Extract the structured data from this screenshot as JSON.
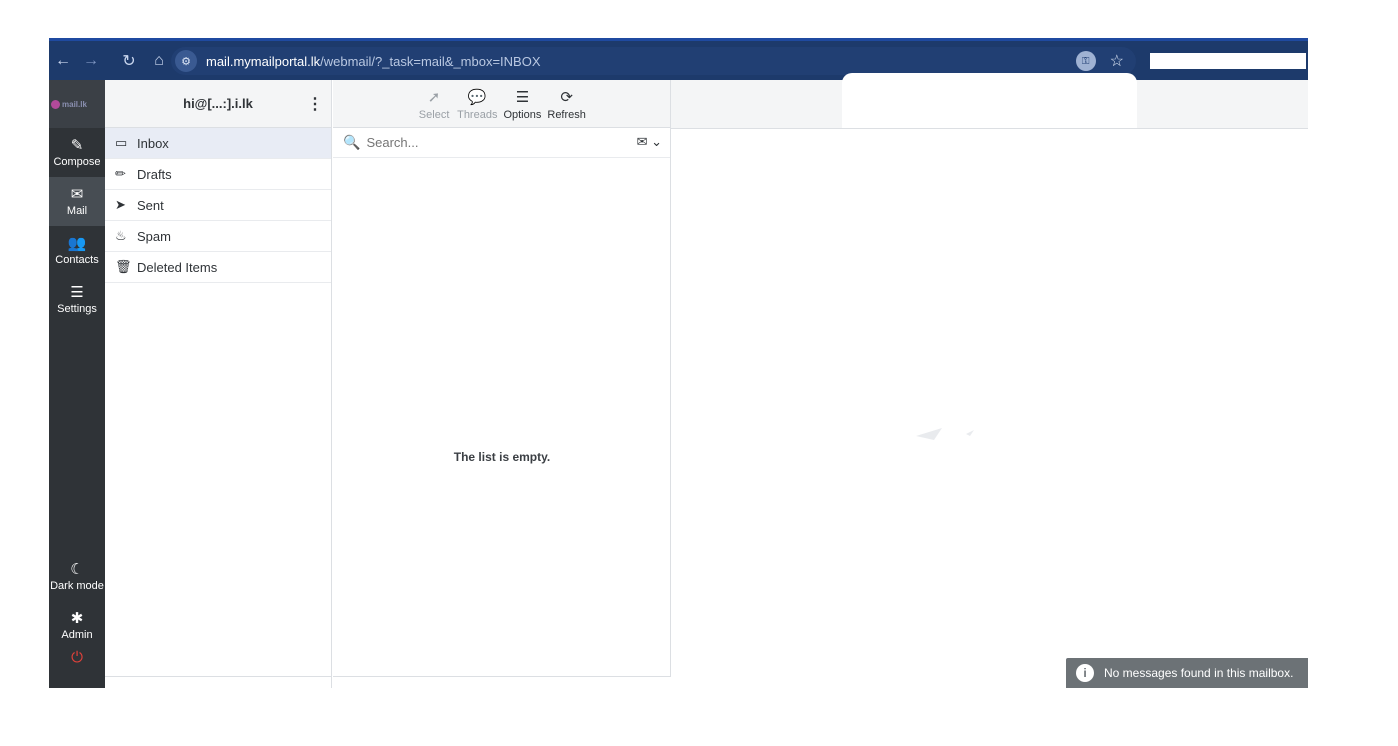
{
  "browser": {
    "url_host": "mail.mymailportal.lk",
    "url_path": "/webmail/?_task=mail&_mbox=INBOX"
  },
  "logo": {
    "text": "mail.lk"
  },
  "taskmenu": {
    "compose": "Compose",
    "mail": "Mail",
    "contacts": "Contacts",
    "settings": "Settings",
    "dark_mode": "Dark mode",
    "admin": "Admin"
  },
  "account": {
    "email": "hi@[...:].i.lk"
  },
  "folders": [
    {
      "label": "Inbox",
      "icon": "inbox-icon",
      "selected": true
    },
    {
      "label": "Drafts",
      "icon": "pencil-icon"
    },
    {
      "label": "Sent",
      "icon": "paper-plane-icon"
    },
    {
      "label": "Spam",
      "icon": "fire-icon"
    },
    {
      "label": "Deleted Items",
      "icon": "trash-icon"
    }
  ],
  "toolbar": {
    "select": "Select",
    "threads": "Threads",
    "options": "Options",
    "refresh": "Refresh"
  },
  "search": {
    "placeholder": "Search..."
  },
  "messagelist": {
    "empty_text": "The list is empty."
  },
  "toast": {
    "text": "No messages found in this mailbox."
  }
}
